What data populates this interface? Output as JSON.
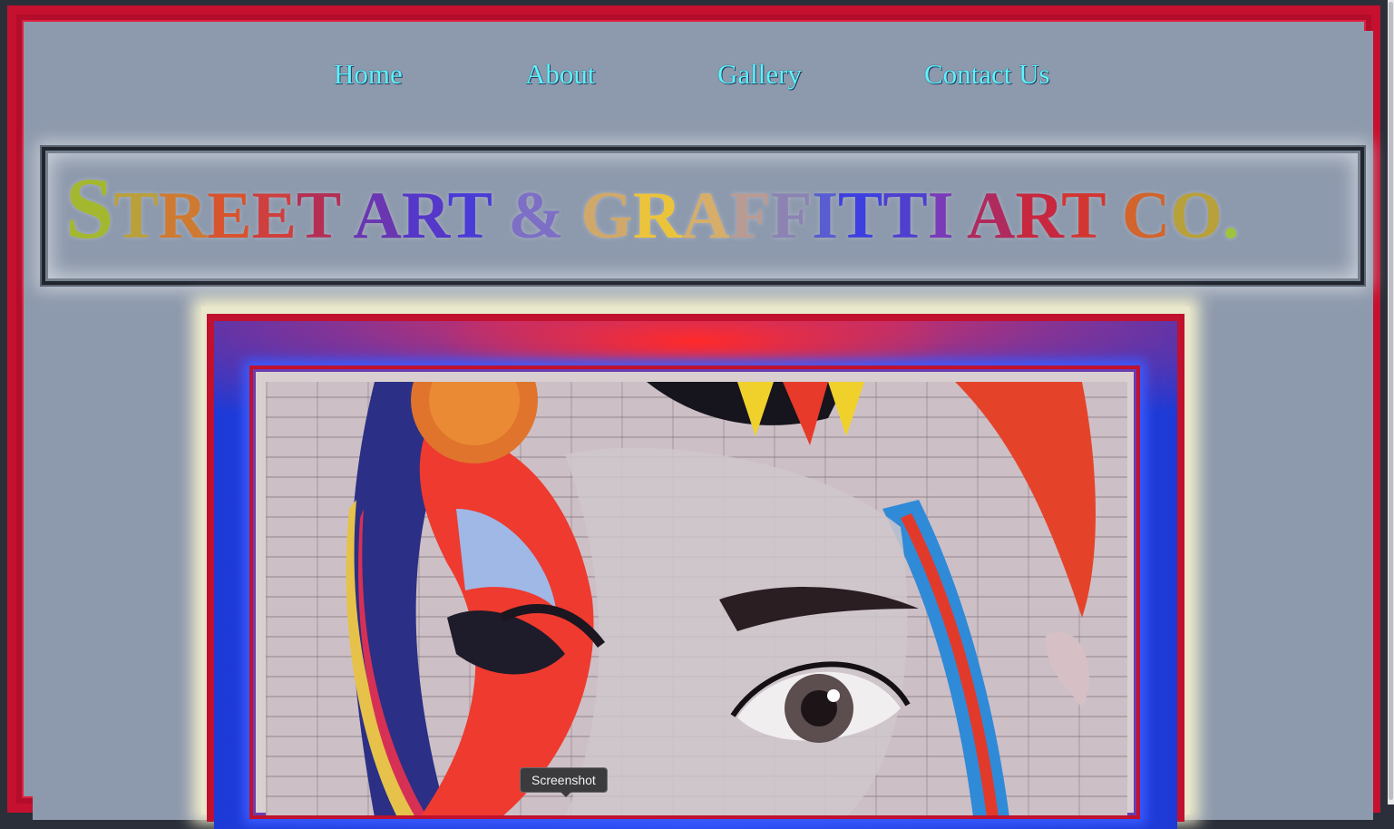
{
  "nav": {
    "home": "Home",
    "about": "About",
    "gallery": "Gallery",
    "contact": "Contact Us"
  },
  "title": {
    "segments": [
      {
        "text": "S",
        "color": "#a3b82f",
        "big": true
      },
      {
        "text": "T",
        "color": "#b9a03b",
        "big": false
      },
      {
        "text": "R",
        "color": "#cf7a31",
        "big": false
      },
      {
        "text": "E",
        "color": "#d8542e",
        "big": false
      },
      {
        "text": "E",
        "color": "#cf3f3d",
        "big": false
      },
      {
        "text": "T",
        "color": "#b52f55",
        "big": false
      },
      {
        "text": " ",
        "color": "#000000",
        "big": false
      },
      {
        "text": "A",
        "color": "#6a36b2",
        "big": false
      },
      {
        "text": "R",
        "color": "#5537c9",
        "big": false
      },
      {
        "text": "T",
        "color": "#4a3bd6",
        "big": false
      },
      {
        "text": " ",
        "color": "#000000",
        "big": false
      },
      {
        "text": "&",
        "color": "#7d6fc5",
        "big": false
      },
      {
        "text": " ",
        "color": "#000000",
        "big": false
      },
      {
        "text": "G",
        "color": "#d0a869",
        "big": false
      },
      {
        "text": "R",
        "color": "#ecc43b",
        "big": false
      },
      {
        "text": "A",
        "color": "#d6ae6a",
        "big": false
      },
      {
        "text": "F",
        "color": "#b99b93",
        "big": false
      },
      {
        "text": "F",
        "color": "#8c83b3",
        "big": false
      },
      {
        "text": "I",
        "color": "#5a5cd1",
        "big": false
      },
      {
        "text": "T",
        "color": "#3d3fe0",
        "big": false
      },
      {
        "text": "T",
        "color": "#4e3fd0",
        "big": false
      },
      {
        "text": "I",
        "color": "#7a3bb8",
        "big": false
      },
      {
        "text": " ",
        "color": "#000000",
        "big": false
      },
      {
        "text": "A",
        "color": "#b02a5d",
        "big": false
      },
      {
        "text": "R",
        "color": "#c8283f",
        "big": false
      },
      {
        "text": "T",
        "color": "#d33631",
        "big": false
      },
      {
        "text": " ",
        "color": "#000000",
        "big": false
      },
      {
        "text": "C",
        "color": "#d3642c",
        "big": false
      },
      {
        "text": "O",
        "color": "#b8a03a",
        "big": false
      },
      {
        "text": ".",
        "color": "#9fc33d",
        "big": false
      }
    ]
  },
  "tooltip": "Screenshot",
  "colors": {
    "page_background": "#8d99ac",
    "border_red": "#c5102f",
    "nav_link": "#5cf3ff",
    "frame_blue": "#2c4cf2"
  }
}
